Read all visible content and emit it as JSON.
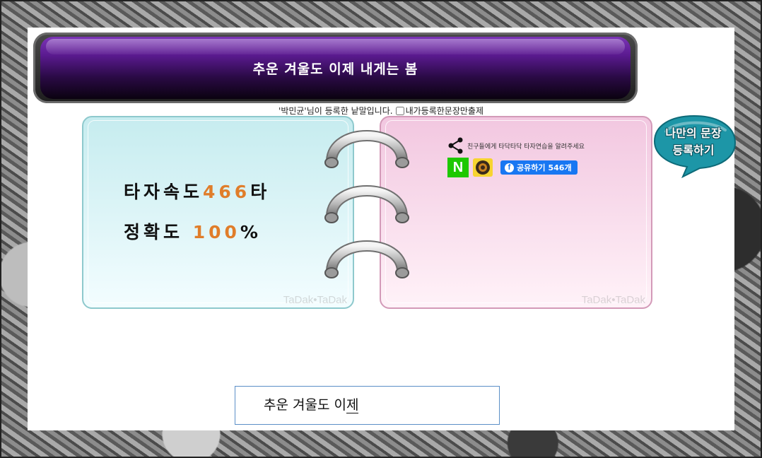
{
  "banner": {
    "title": "추운 겨울도 이제 내게는 봄"
  },
  "registration": {
    "text": "'박민균'님이 등록한 낱말입니다.",
    "checkbox_label": "내가등록한문장만출제",
    "checkbox_checked": false
  },
  "stats": {
    "speed_label": "타자속도",
    "speed_value": "466",
    "speed_unit": "타",
    "accuracy_label": "정확도",
    "accuracy_value": "100",
    "accuracy_unit": "%"
  },
  "watermark": "TaDak•TaDak",
  "share": {
    "text": "친구들에게 타닥타닥 타자연습을 알려주세요",
    "naver_label": "N",
    "facebook_label": "공유하기",
    "facebook_count": "546개"
  },
  "register_bubble": {
    "line1": "나만의 문장",
    "line2": "등록하기"
  },
  "typing_input": {
    "typed": "추운 겨울도 이",
    "composing": "제"
  },
  "colors": {
    "banner": "#5a1a8f",
    "accent_number": "#e07d2a",
    "left_card": "#c6ecef",
    "right_card": "#f2c7e0",
    "bubble": "#1a8fa0",
    "facebook": "#1877f2",
    "naver": "#1ec800"
  },
  "icons": [
    "share-icon",
    "naver-icon",
    "kakaostory-icon",
    "facebook-icon",
    "ring-binder-icon"
  ]
}
